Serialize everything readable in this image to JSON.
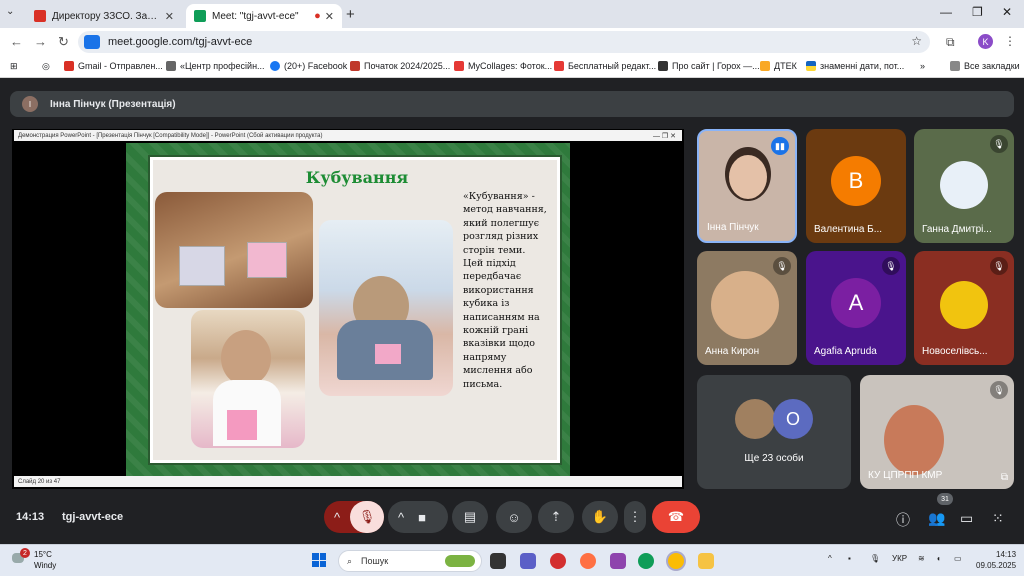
{
  "browser": {
    "tabs": [
      {
        "label": "Директору ЗЗСО. Запрошення",
        "active": false
      },
      {
        "label": "Meet: \"tgj-avvt-ece\"",
        "active": true
      }
    ],
    "new_tab_glyph": "+",
    "url": "meet.google.com/tgj-avvt-ece",
    "profile_initial": "K",
    "bookmarks": [
      "Gmail - Отправлен...",
      "«Центр професійн...",
      "(20+) Facebook",
      "Початок 2024/2025...",
      "MyCollages: Фоток...",
      "Бесплатный редакт...",
      "Про сайт | Горох —...",
      "ДТЕК",
      "знаменні дати, пот..."
    ],
    "all_bookmarks": "Все закладки"
  },
  "meet": {
    "presenter_initial": "І",
    "presenter_label": "Інна Пінчук (Презентація)",
    "ppt_titlebar": "Демонстрация PowerPoint - [Презентація Пінчук [Compatibility Mode]] - PowerPoint (Сбой активации продукта)",
    "ppt_status": "Слайд 20 из 47",
    "slide": {
      "title": "Кубування",
      "body": "«Кубування» - метод навчання, який полегшує розгляд різних сторін теми. Цей підхід передбачає використання кубика із написанням на кожній грані вказівки щодо напряму мислення або письма."
    },
    "participants": [
      {
        "name": "Інна Пінчук",
        "initial": "",
        "color": "#c9b5a8"
      },
      {
        "name": "Валентина Б...",
        "initial": "B",
        "color": "#f57c00"
      },
      {
        "name": "Ганна Дмитрі...",
        "initial": "",
        "color": "#5a6b4a"
      },
      {
        "name": "Анна Кирон",
        "initial": "",
        "color": "#b08d66"
      },
      {
        "name": "Agafia Apruda",
        "initial": "A",
        "color": "#7b1fa2"
      },
      {
        "name": "Новоселівсь...",
        "initial": "",
        "color": "#a33a2a"
      },
      {
        "name": "КУ ЦПРПП КМР",
        "initial": "",
        "color": "#c9c3bd"
      }
    ],
    "others": {
      "label": "Ще 23 особи",
      "initial": "O"
    },
    "time": "14:13",
    "meeting_code": "tgj-avvt-ece",
    "people_count": "31"
  },
  "taskbar": {
    "weather_temp": "15°C",
    "weather_desc": "Windy",
    "weather_badge": "2",
    "search_placeholder": "Пошук",
    "lang": "УКР",
    "time": "14:13",
    "date": "09.05.2025"
  }
}
